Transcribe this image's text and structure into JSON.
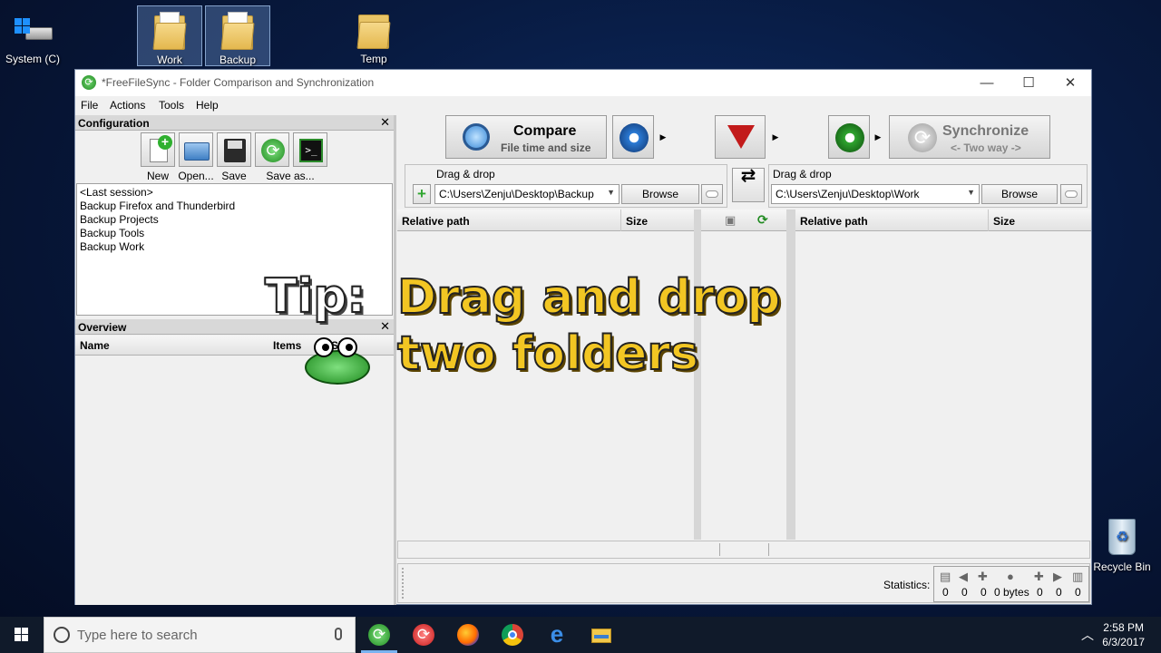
{
  "desktop": {
    "icons": [
      {
        "label": "System (C)"
      },
      {
        "label": "Work"
      },
      {
        "label": "Backup"
      },
      {
        "label": "Temp"
      },
      {
        "label": "Recycle Bin"
      }
    ]
  },
  "window": {
    "title": "*FreeFileSync - Folder Comparison and Synchronization",
    "menu": [
      "File",
      "Actions",
      "Tools",
      "Help"
    ],
    "configuration": {
      "header": "Configuration",
      "buttons": [
        "New",
        "Open...",
        "Save",
        "Save as..."
      ],
      "items": [
        "<Last session>",
        "Backup Firefox and Thunderbird",
        "Backup Projects",
        "Backup Tools",
        "Backup Work"
      ]
    },
    "overview": {
      "header": "Overview",
      "columns": [
        "Name",
        "Items",
        "Size"
      ]
    },
    "toolbar": {
      "compare_label": "Compare",
      "compare_sub": "File time and size",
      "sync_label": "Synchronize",
      "sync_sub": "<- Two way ->"
    },
    "left_folder": {
      "drag_label": "Drag & drop",
      "path": "C:\\Users\\Zenju\\Desktop\\Backup",
      "browse": "Browse"
    },
    "right_folder": {
      "drag_label": "Drag & drop",
      "path": "C:\\Users\\Zenju\\Desktop\\Work",
      "browse": "Browse"
    },
    "grid": {
      "left_cols": [
        "Relative path",
        "Size"
      ],
      "right_cols": [
        "Relative path",
        "Size"
      ]
    },
    "statistics": {
      "label": "Statistics:",
      "values": [
        "0",
        "0",
        "0",
        "0 bytes",
        "0",
        "0",
        "0"
      ]
    }
  },
  "tip": {
    "label": "Tip:",
    "line1": "Drag and drop",
    "line2": "two folders"
  },
  "taskbar": {
    "search_placeholder": "Type here to search",
    "time": "2:58 PM",
    "date": "6/3/2017"
  }
}
